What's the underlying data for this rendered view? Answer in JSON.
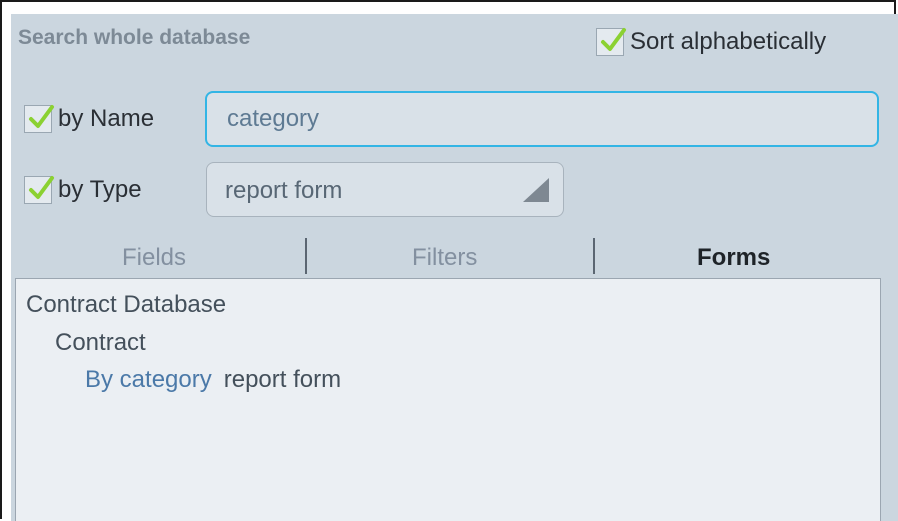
{
  "heading": "Search whole database",
  "sort": {
    "label": "Sort alphabetically",
    "checked": true
  },
  "by_name": {
    "label": "by Name",
    "checked": true,
    "value": "category"
  },
  "by_type": {
    "label": "by Type",
    "checked": true,
    "value": "report form"
  },
  "tabs": [
    {
      "label": "Fields",
      "active": false
    },
    {
      "label": "Filters",
      "active": false
    },
    {
      "label": "Forms",
      "active": true
    }
  ],
  "results": {
    "database": "Contract Database",
    "table": "Contract",
    "items": [
      {
        "name": "By category",
        "type": "report form"
      }
    ]
  },
  "colors": {
    "panel_bg": "#cbd6df",
    "focus_border": "#33b5e5",
    "checkmark": "#8bd132",
    "link_text": "#4b79a8"
  },
  "icons": {
    "check": "check-icon",
    "dropdown": "triangle-dropdown-icon"
  }
}
